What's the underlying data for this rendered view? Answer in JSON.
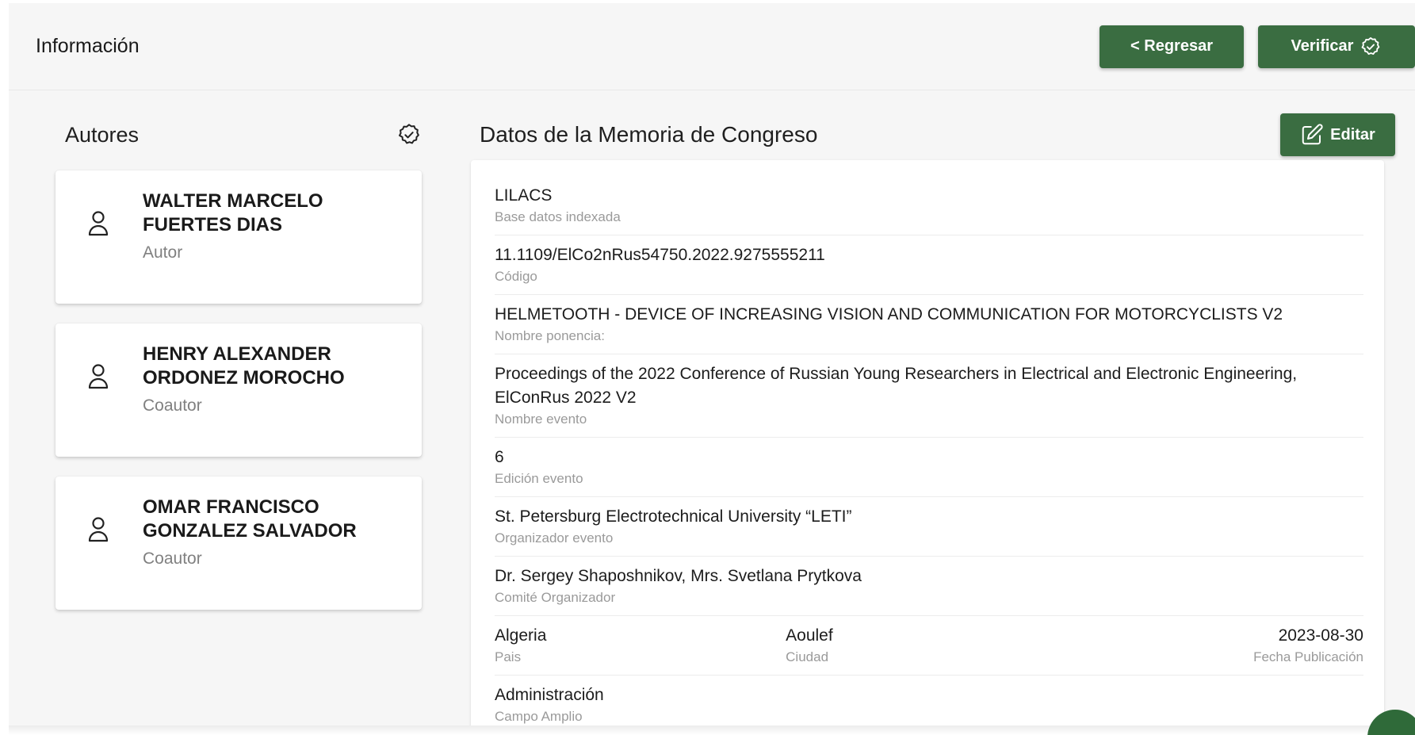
{
  "header": {
    "title": "Información",
    "back_label": "< Regresar",
    "verify_label": "Verificar"
  },
  "authors": {
    "title": "Autores",
    "items": [
      {
        "name": "WALTER MARCELO FUERTES DIAS",
        "role": "Autor"
      },
      {
        "name": "HENRY ALEXANDER ORDONEZ MOROCHO",
        "role": "Coautor"
      },
      {
        "name": "OMAR FRANCISCO GONZALEZ SALVADOR",
        "role": "Coautor"
      }
    ]
  },
  "details": {
    "title": "Datos de la Memoria de Congreso",
    "edit_label": "Editar",
    "fields": [
      {
        "value": "LILACS",
        "label": "Base datos indexada"
      },
      {
        "value": "11.1109/ElCo2nRus54750.2022.9275555211",
        "label": "Código"
      },
      {
        "value": "HELMETOOTH - DEVICE OF INCREASING VISION AND COMMUNICATION FOR MOTORCYCLISTS V2",
        "label": "Nombre ponencia:"
      },
      {
        "value": "Proceedings of the 2022 Conference of Russian Young Researchers in Electrical and Electronic Engineering, ElConRus 2022 V2",
        "label": "Nombre evento"
      },
      {
        "value": "6",
        "label": "Edición evento"
      },
      {
        "value": "St. Petersburg Electrotechnical University “LETI”",
        "label": "Organizador evento"
      },
      {
        "value": "Dr. Sergey Shaposhnikov, Mrs. Svetlana Prytkova",
        "label": "Comité Organizador"
      }
    ],
    "location": {
      "country": {
        "value": "Algeria",
        "label": "Pais"
      },
      "city": {
        "value": "Aoulef",
        "label": "Ciudad"
      },
      "date": {
        "value": "2023-08-30",
        "label": "Fecha Publicación"
      }
    },
    "field_broad": {
      "value": "Administración",
      "label": "Campo Amplio"
    }
  },
  "colors": {
    "accent": "#3a6d41",
    "background": "#f6f6f6"
  },
  "icons": [
    "person-icon",
    "check-circle-icon",
    "edit-icon"
  ]
}
